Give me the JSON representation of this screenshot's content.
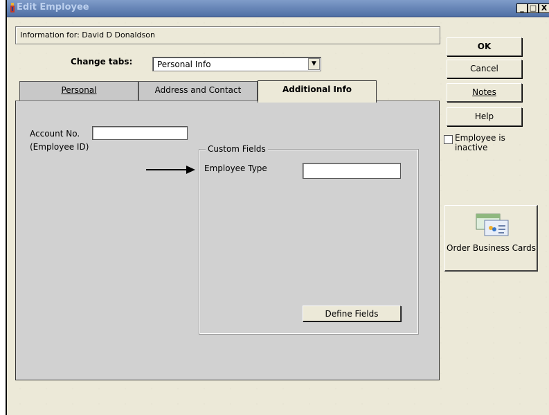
{
  "window": {
    "title": "Edit Employee",
    "controls": {
      "minimize": "_",
      "maximize": "□",
      "close": "X"
    }
  },
  "info_label": "Information for: David D Donaldson",
  "change_tabs": {
    "label": "Change tabs:",
    "selected": "Personal Info"
  },
  "tabs": [
    {
      "label": "Personal",
      "active": false
    },
    {
      "label": "Address and Contact",
      "active": false
    },
    {
      "label": "Additional Info",
      "active": true
    }
  ],
  "panel": {
    "account_label": "Account No.",
    "account_sublabel": "(Employee ID)",
    "account_value": "",
    "custom_fields": {
      "title": "Custom Fields",
      "fields": [
        {
          "label": "Employee Type",
          "value": ""
        }
      ],
      "define_button": "Define Fields"
    }
  },
  "buttons": {
    "ok": "OK",
    "cancel": "Cancel",
    "notes": "Notes",
    "help": "Help"
  },
  "inactive_checkbox": {
    "label": "Employee is inactive",
    "checked": false
  },
  "order_business_cards": "Order Business Cards",
  "icons": [
    "app-icon",
    "dropdown-arrow-icon",
    "arrow-pointer-icon",
    "business-cards-icon",
    "minimize-icon",
    "maximize-icon",
    "close-icon"
  ]
}
